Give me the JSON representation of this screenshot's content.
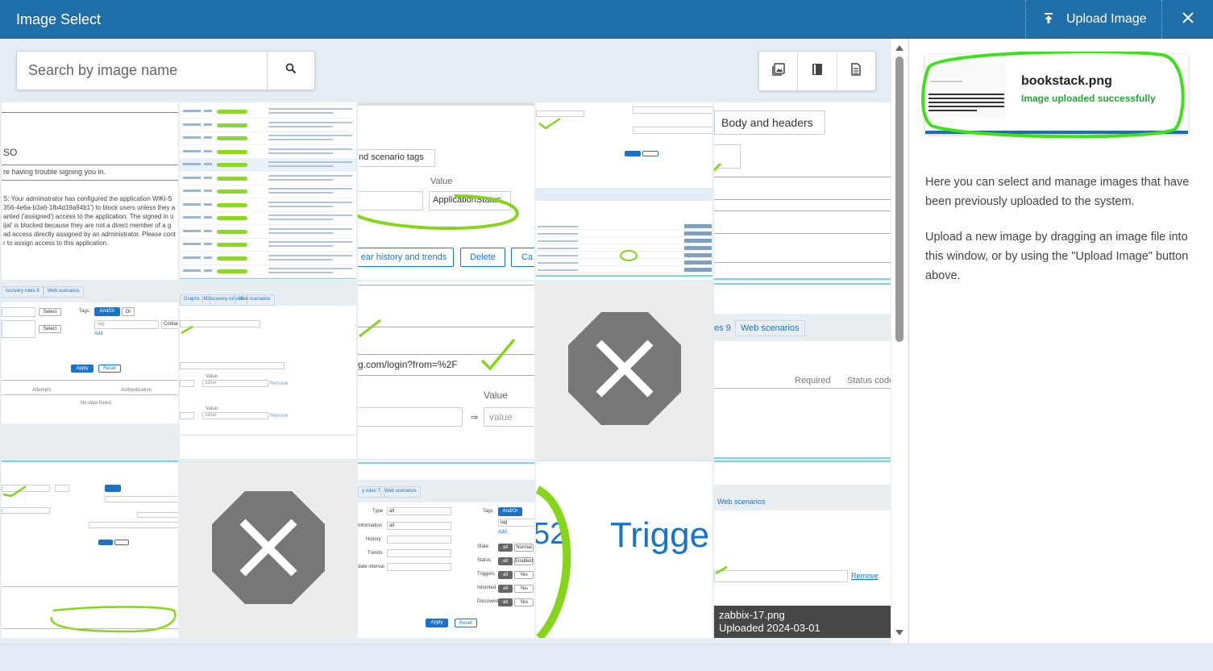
{
  "header": {
    "title": "Image Select",
    "upload_label": "Upload Image",
    "upload_icon": "upload-icon",
    "close_icon": "close-icon"
  },
  "search": {
    "placeholder": "Search by image name",
    "value": "",
    "icon": "search-icon"
  },
  "filters": [
    {
      "name": "gallery-filter",
      "icon": "image-icon"
    },
    {
      "name": "book-filter",
      "icon": "book-icon"
    },
    {
      "name": "page-filter",
      "icon": "page-icon"
    }
  ],
  "tiles": [
    {
      "kind": "sso",
      "texts": [
        "SO",
        "re having trouble signing you in.",
        "S: Your administrator has configured the application WiKi-S",
        "356-4e6a-b3a6-1fb4d19a94b1') to block users unless they a",
        "anted ('assigned') access to the application. The signed in u",
        "ijal' is blocked because they are not a direct member of a g",
        "ad access directly assigned by an administrator. Please cont",
        "r to assign access to this application."
      ]
    },
    {
      "kind": "list"
    },
    {
      "kind": "scenario",
      "texts": [
        "nd scenario tags",
        "Value",
        "ApplicationStatus",
        "ear history and trends",
        "Delete",
        "Ca"
      ]
    },
    {
      "kind": "filters-top"
    },
    {
      "kind": "body-headers",
      "texts": [
        "Body and headers"
      ]
    },
    {
      "kind": "discovery",
      "texts": [
        "iscovery rules 8",
        "Web scenarios",
        "Select",
        "Tags",
        "And/Or",
        "Or",
        "Select",
        "tag",
        "Contains",
        "Add",
        "Apply",
        "Reset",
        "Attempts",
        "Authentication",
        "No data found."
      ]
    },
    {
      "kind": "web-form",
      "texts": [
        "Graphs 16",
        "Discovery rules 8",
        "Web scenarios",
        "Value",
        "value",
        "Remove",
        "Value",
        "value",
        "Remove"
      ]
    },
    {
      "kind": "login",
      "texts": [
        "g.com/login?from=%2F",
        "Value",
        "value"
      ]
    },
    {
      "kind": "broken"
    },
    {
      "kind": "web-scenarios",
      "texts": [
        "es 9",
        "Web scenarios",
        "Required",
        "Status code"
      ]
    },
    {
      "kind": "filter-bottom"
    },
    {
      "kind": "broken"
    },
    {
      "kind": "rules",
      "texts": [
        "y rules 7",
        "Web scenarios",
        "Type",
        "all",
        "Information",
        "all",
        "History",
        "Trends",
        "date interval",
        "Tags",
        "And/Or",
        "tag",
        "Add",
        "State",
        "all",
        "Normal",
        "Status",
        "all",
        "Enabled",
        "Triggers",
        "all",
        "Yes",
        "Inherited",
        "all",
        "Yes",
        "Discovered",
        "all",
        "Yes",
        "Apply",
        "Reset"
      ]
    },
    {
      "kind": "trigger",
      "texts": [
        "52",
        "Trigge"
      ]
    },
    {
      "kind": "zabbix",
      "texts": [
        "Web scenarios",
        "Remove"
      ],
      "caption_name": "zabbix-17.png",
      "caption_date": "Uploaded 2024-03-01"
    }
  ],
  "uploaded": {
    "filename": "bookstack.png",
    "status": "Image uploaded successfully"
  },
  "help": {
    "p1": "Here you can select and manage images that have been previously uploaded to the system.",
    "p2": "Upload a new image by dragging an image file into this window, or by using the \"Upload Image\" button above."
  }
}
